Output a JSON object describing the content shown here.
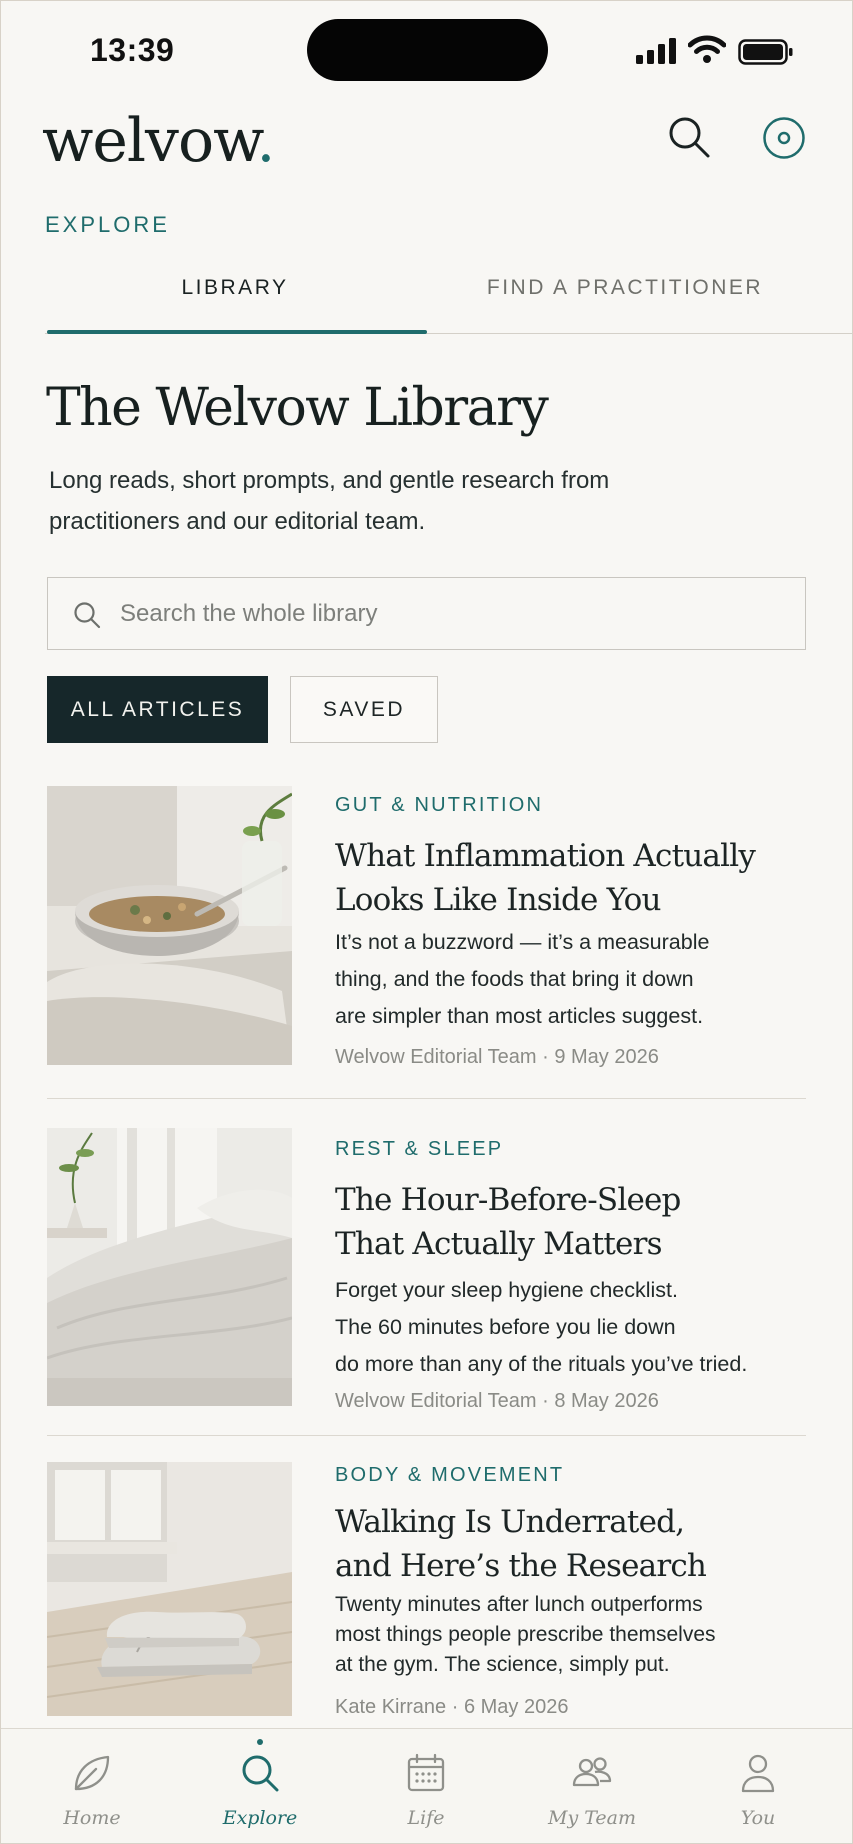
{
  "status_bar": {
    "time": "13:39"
  },
  "app": {
    "logo_text": "welvow",
    "logo_dot": ".",
    "accent_color": "#1f6c6c"
  },
  "header": {
    "search_icon": "search-icon",
    "settings_icon": "settings-icon"
  },
  "section_label": "EXPLORE",
  "tabs": [
    {
      "label": "LIBRARY",
      "active": true
    },
    {
      "label": "FIND A PRACTITIONER",
      "active": false
    }
  ],
  "page": {
    "title": "The Welvow Library",
    "description": "Long reads, short prompts, and gentle research from practitioners and our editorial team."
  },
  "search": {
    "placeholder": "Search the whole library",
    "value": ""
  },
  "filters": [
    {
      "label": "ALL ARTICLES",
      "active": true
    },
    {
      "label": "SAVED",
      "active": false
    }
  ],
  "articles": [
    {
      "category": "GUT & NUTRITION",
      "title_lines": [
        "What Inflammation Actually",
        "Looks Like Inside You"
      ],
      "excerpt_lines": [
        "It’s not a buzzword — it’s a measurable",
        "thing, and the foods that bring it down",
        "are simpler than most articles suggest."
      ],
      "author": "Welvow Editorial Team",
      "separator": " · ",
      "date": "9 May 2026",
      "image": "bowl-of-food-photo"
    },
    {
      "category": "REST & SLEEP",
      "title_lines": [
        "The Hour-Before-Sleep",
        "That Actually Matters"
      ],
      "excerpt_lines": [
        "Forget your sleep hygiene checklist.",
        "The 60 minutes before you lie down",
        "do more than any of the rituals you’ve tried."
      ],
      "author": "Welvow Editorial Team",
      "separator": " · ",
      "date": "8 May 2026",
      "image": "bed-linen-photo"
    },
    {
      "category": "BODY & MOVEMENT",
      "title_lines": [
        "Walking Is Underrated,",
        "and Here’s the Research"
      ],
      "excerpt_lines": [
        "Twenty minutes after lunch outperforms",
        "most things people prescribe themselves",
        "at the gym. The science, simply put."
      ],
      "author": "Kate Kirrane",
      "separator": " · ",
      "date": "6 May 2026",
      "image": "sneakers-photo"
    }
  ],
  "bottom_nav": [
    {
      "label": "Home",
      "icon": "leaf-icon",
      "active": false
    },
    {
      "label": "Explore",
      "icon": "search-icon",
      "active": true
    },
    {
      "label": "Life",
      "icon": "calendar-icon",
      "active": false
    },
    {
      "label": "My Team",
      "icon": "team-icon",
      "active": false
    },
    {
      "label": "You",
      "icon": "person-icon",
      "active": false
    }
  ]
}
